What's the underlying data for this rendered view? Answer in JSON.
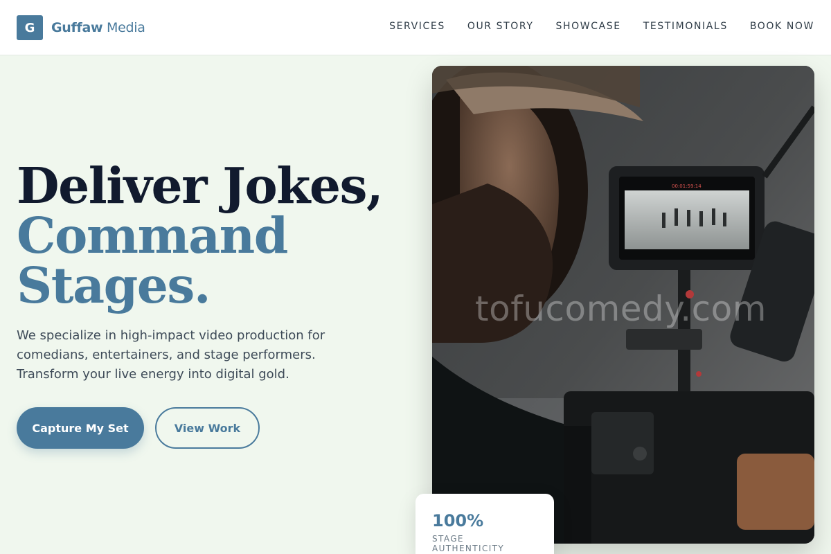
{
  "brand": {
    "mark": "G",
    "name_bold": "Guffaw",
    "name_light": "Media",
    "accent_color": "#497a9c"
  },
  "nav": {
    "items": [
      {
        "label": "SERVICES"
      },
      {
        "label": "OUR STORY"
      },
      {
        "label": "SHOWCASE"
      },
      {
        "label": "TESTIMONIALS"
      },
      {
        "label": "BOOK NOW"
      }
    ]
  },
  "hero": {
    "title_line1": "Deliver Jokes,",
    "title_line2": "Command",
    "title_line3": "Stages.",
    "description": "We specialize in high-impact video production for comedians, entertainers, and stage performers. Transform your live energy into digital gold.",
    "primary_cta": "Capture My Set",
    "secondary_cta": "View Work"
  },
  "media": {
    "watermark": "tofucomedy.com",
    "monitor_readout": "00:01:59:14"
  },
  "stat": {
    "value": "100%",
    "label": "STAGE AUTHENTICITY"
  }
}
